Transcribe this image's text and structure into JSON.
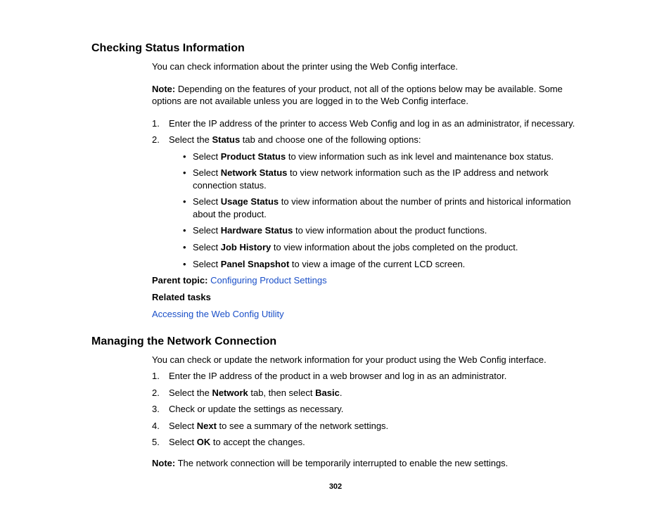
{
  "section1": {
    "heading": "Checking Status Information",
    "intro": "You can check information about the printer using the Web Config interface.",
    "note_label": "Note:",
    "note_text": " Depending on the features of your product, not all of the options below may be available. Some options are not available unless you are logged in to the Web Config interface.",
    "step1": "Enter the IP address of the printer to access Web Config and log in as an administrator, if necessary.",
    "step2_pre": "Select the ",
    "step2_bold": "Status",
    "step2_post": " tab and choose one of the following options:",
    "b1_pre": "Select ",
    "b1_bold": "Product Status",
    "b1_post": " to view information such as ink level and maintenance box status.",
    "b2_pre": "Select ",
    "b2_bold": "Network Status",
    "b2_post": " to view network information such as the IP address and network connection status.",
    "b3_pre": "Select ",
    "b3_bold": "Usage Status",
    "b3_post": " to view information about the number of prints and historical information about the product.",
    "b4_pre": "Select ",
    "b4_bold": "Hardware Status",
    "b4_post": " to view information about the product functions.",
    "b5_pre": "Select ",
    "b5_bold": "Job History",
    "b5_post": " to view information about the jobs completed on the product.",
    "b6_pre": "Select ",
    "b6_bold": "Panel Snapshot",
    "b6_post": " to view a image of the current LCD screen.",
    "parent_label": "Parent topic:",
    "parent_link": "Configuring Product Settings",
    "related_label": "Related tasks",
    "related_link": "Accessing the Web Config Utility"
  },
  "section2": {
    "heading": "Managing the Network Connection",
    "intro": "You can check or update the network information for your product using the Web Config interface.",
    "s1": "Enter the IP address of the product in a web browser and log in as an administrator.",
    "s2_pre": "Select the ",
    "s2_b1": "Network",
    "s2_mid": " tab, then select ",
    "s2_b2": "Basic",
    "s2_post": ".",
    "s3": "Check or update the settings as necessary.",
    "s4_pre": "Select ",
    "s4_bold": "Next",
    "s4_post": " to see a summary of the network settings.",
    "s5_pre": "Select ",
    "s5_bold": "OK",
    "s5_post": " to accept the changes.",
    "note_label": "Note:",
    "note_text": " The network connection will be temporarily interrupted to enable the new settings."
  },
  "page_number": "302"
}
